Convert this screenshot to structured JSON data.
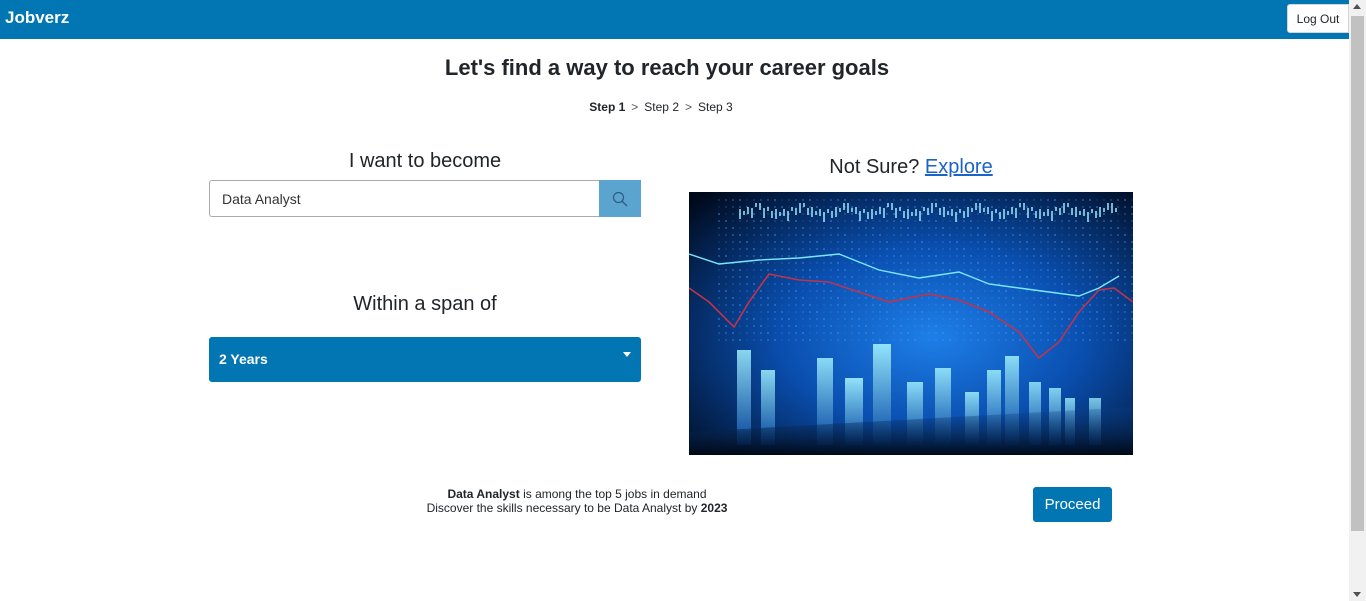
{
  "app": {
    "brand": "Jobverz",
    "logout_label": "Log Out"
  },
  "header": {
    "title": "Let's find a way to reach your career goals",
    "steps": [
      {
        "label": "Step 1",
        "active": true
      },
      {
        "label": "Step 2",
        "active": false
      },
      {
        "label": "Step 3",
        "active": false
      }
    ],
    "step_separator": ">"
  },
  "form": {
    "become_label": "I want to become",
    "role_value": "Data Analyst",
    "search_icon": "search-icon",
    "span_label": "Within a span of",
    "span_value": "2 Years"
  },
  "explore": {
    "prompt": "Not Sure?",
    "link": "Explore"
  },
  "info": {
    "role": "Data Analyst",
    "line1_rest": "is among the top 5 jobs in demand",
    "line2_prefix": "Discover the skills necessary to be Data Analyst by",
    "year": "2023"
  },
  "actions": {
    "proceed_label": "Proceed"
  },
  "colors": {
    "primary": "#0276b3",
    "search_button": "#5ba4d0",
    "link": "#1a63c9"
  }
}
